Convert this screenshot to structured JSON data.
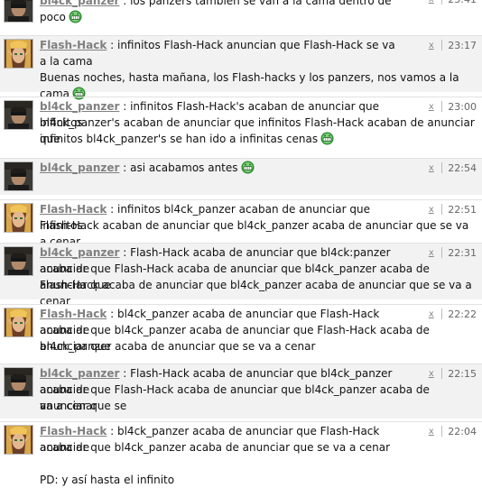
{
  "messages": [
    {
      "user": "bl4ck_panzer",
      "time": "23:41",
      "lines": [
        ": los panzers tambien se van a la cama dentro de poco"
      ],
      "smile_line": 0
    },
    {
      "user": "Flash-Hack",
      "time": "23:17",
      "lines": [
        ": infinitos Flash-Hack anuncian que Flash-Hack se va a la cama",
        "",
        "Buenas noches, hasta mañana, los Flash-hacks y los panzers, nos vamos a la cama"
      ],
      "smile_line": 2
    },
    {
      "user": "bl4ck_panzer",
      "time": "23:00",
      "lines": [
        ": infinitos Flash-Hack's acaban de anunciar que infinitos",
        "bl4ck_panzer's acaban de anunciar que infinitos Flash-Hack acaban de anunciar que",
        "infinitos bl4ck_panzer's se han ido a infinitas cenas"
      ],
      "smile_line": 2
    },
    {
      "user": "bl4ck_panzer",
      "time": "22:54",
      "lines": [
        ": asi acabamos antes"
      ],
      "smile_line": 0
    },
    {
      "user": "Flash-Hack",
      "time": "22:51",
      "lines": [
        ": infinitos bl4ck_panzer acaban de anunciar que infinitos",
        "Flash-Hack acaban de anunciar que bl4ck_panzer acaba de anunciar que se va a cenar"
      ],
      "smile_line": -1
    },
    {
      "user": "bl4ck_panzer",
      "time": "22:31",
      "lines": [
        ": Flash-Hack acaba de anunciar que bl4ck:panzer acaba de",
        "anunciar que Flash-Hack acaba de anunciar que bl4ck_panzer acaba de anunciar que",
        "Flash-Hack acaba de anunciar que bl4ck_panzer acaba de anunciar que se va a cenar"
      ],
      "smile_line": -1
    },
    {
      "user": "Flash-Hack",
      "time": "22:22",
      "lines": [
        ": bl4ck_panzer acaba de anunciar que Flash-Hack acaba de",
        "anunciar que bl4ck_panzer acaba de anunciar que Flash-Hack acaba de anunciar que",
        "bl4ck_panzer acaba de anunciar que se va a cenar"
      ],
      "smile_line": -1
    },
    {
      "user": "bl4ck_panzer",
      "time": "22:15",
      "lines": [
        ": Flash-Hack acaba de anunciar que bl4ck_panzer acaba de",
        "anunciar que Flash-Hack acaba de anunciar que bl4ck_panzer acaba de anunciar que se",
        "va a cenar"
      ],
      "smile_line": -1
    },
    {
      "user": "Flash-Hack",
      "time": "22:04",
      "lines": [
        ": bl4ck_panzer acaba de anunciar que Flash-Hack acaba de",
        "anunciar que bl4ck_panzer acaba de anunciar que se va a cenar",
        "",
        "PD: y así hasta el infinito"
      ],
      "smile_line": -1
    }
  ],
  "delete_symbol": "x",
  "icons": {
    "panzer_avatar": "panzer-avatar",
    "hack_avatar": "elf-avatar",
    "smiley": "grin-smiley-icon"
  },
  "colors": {
    "username": "#808080",
    "shaded_row": "#f2f2f2",
    "smiley": "#2e8b2e"
  }
}
